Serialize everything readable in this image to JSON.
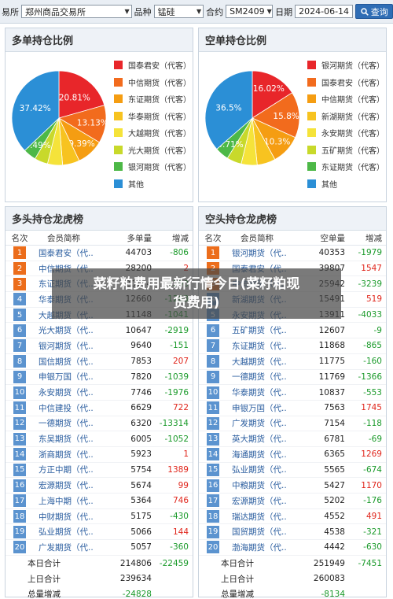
{
  "topbar": {
    "exchange_label": "易所",
    "exchange_value": "郑州商品交易所",
    "variety_label": "品种",
    "variety_value": "锰硅",
    "contract_label": "合约",
    "contract_value": "SM2409",
    "date_label": "日期",
    "date_value": "2024-06-14",
    "query_label": "查询"
  },
  "long_pie": {
    "title": "多单持仓比例",
    "slices": [
      {
        "name": "国泰君安（代客）",
        "pct": 20.81,
        "color": "#e8262a",
        "label": "20.81%"
      },
      {
        "name": "中信期货（代客）",
        "pct": 13.13,
        "color": "#f26b1d",
        "label": "13.13%"
      },
      {
        "name": "东证期货（代客）",
        "pct": 9.39,
        "color": "#f59d12",
        "label": "9.39%"
      },
      {
        "name": "华泰期货（代客）",
        "pct": 5.9,
        "color": "#f7c320",
        "label": ""
      },
      {
        "name": "大越期货（代客）",
        "pct": 5.2,
        "color": "#f5e33a",
        "label": ""
      },
      {
        "name": "光大期货（代客）",
        "pct": 4.6,
        "color": "#c8d92b",
        "label": ""
      },
      {
        "name": "银河期货（代客）",
        "pct": 4.49,
        "color": "#4db847",
        "label": "4.49%"
      },
      {
        "name": "其他",
        "pct": 37.42,
        "color": "#2b8fd6",
        "label": "37.42%"
      }
    ]
  },
  "short_pie": {
    "title": "空单持仓比例",
    "slices": [
      {
        "name": "银河期货（代客）",
        "pct": 16.02,
        "color": "#e8262a",
        "label": "16.02%"
      },
      {
        "name": "国泰君安（代客）",
        "pct": 15.8,
        "color": "#f26b1d",
        "label": "15.8%"
      },
      {
        "name": "中信期货（代客）",
        "pct": 10.3,
        "color": "#f59d12",
        "label": "10.3%"
      },
      {
        "name": "新湖期货（代客）",
        "pct": 6.3,
        "color": "#f7c320",
        "label": ""
      },
      {
        "name": "永安期货（代客）",
        "pct": 5.5,
        "color": "#f5e33a",
        "label": ""
      },
      {
        "name": "五矿期货（代客）",
        "pct": 5.07,
        "color": "#c8d92b",
        "label": ""
      },
      {
        "name": "东证期货（代客）",
        "pct": 4.71,
        "color": "#4db847",
        "label": "4.71%"
      },
      {
        "name": "其他",
        "pct": 36.5,
        "color": "#2b8fd6",
        "label": "36.5%"
      }
    ]
  },
  "long_table": {
    "title": "多头持仓龙虎榜",
    "headers": [
      "名次",
      "会员简称",
      "多单量",
      "增减"
    ],
    "rows": [
      {
        "rank": "1",
        "name": "国泰君安（代...",
        "vol": "44703",
        "chg": "-806"
      },
      {
        "rank": "2",
        "name": "中信期货（代...",
        "vol": "28200",
        "chg": "2"
      },
      {
        "rank": "3",
        "name": "东证期货（代...",
        "vol": "20174",
        "chg": "-1290"
      },
      {
        "rank": "4",
        "name": "华泰期货（代...",
        "vol": "12660",
        "chg": "-1263"
      },
      {
        "rank": "5",
        "name": "大越期货（代...",
        "vol": "11148",
        "chg": "-1041"
      },
      {
        "rank": "6",
        "name": "光大期货（代...",
        "vol": "10647",
        "chg": "-2919"
      },
      {
        "rank": "7",
        "name": "银河期货（代...",
        "vol": "9640",
        "chg": "-151"
      },
      {
        "rank": "8",
        "name": "国信期货（代...",
        "vol": "7853",
        "chg": "207"
      },
      {
        "rank": "9",
        "name": "申银万国（代...",
        "vol": "7820",
        "chg": "-1039"
      },
      {
        "rank": "10",
        "name": "永安期货（代...",
        "vol": "7746",
        "chg": "-1976"
      },
      {
        "rank": "11",
        "name": "中信建投（代...",
        "vol": "6629",
        "chg": "722"
      },
      {
        "rank": "12",
        "name": "一德期货（代...",
        "vol": "6320",
        "chg": "-13314"
      },
      {
        "rank": "13",
        "name": "东吴期货（代...",
        "vol": "6005",
        "chg": "-1052"
      },
      {
        "rank": "14",
        "name": "浙商期货（代...",
        "vol": "5923",
        "chg": "1"
      },
      {
        "rank": "15",
        "name": "方正中期（代...",
        "vol": "5754",
        "chg": "1389"
      },
      {
        "rank": "16",
        "name": "宏源期货（代...",
        "vol": "5674",
        "chg": "99"
      },
      {
        "rank": "17",
        "name": "上海中期（代...",
        "vol": "5364",
        "chg": "746"
      },
      {
        "rank": "18",
        "name": "中财期货（代...",
        "vol": "5175",
        "chg": "-430"
      },
      {
        "rank": "19",
        "name": "弘业期货（代...",
        "vol": "5066",
        "chg": "144"
      },
      {
        "rank": "20",
        "name": "广发期货（代...",
        "vol": "5057",
        "chg": "-360"
      }
    ],
    "summary": [
      {
        "label": "本日合计",
        "vol": "214806",
        "chg": "-22459"
      },
      {
        "label": "上日合计",
        "vol": "239634",
        "chg": ""
      },
      {
        "label": "总量增减",
        "vol": "-24828",
        "chg": ""
      }
    ]
  },
  "short_table": {
    "title": "空头持仓龙虎榜",
    "headers": [
      "名次",
      "会员简称",
      "空单量",
      "增减"
    ],
    "rows": [
      {
        "rank": "1",
        "name": "银河期货（代...",
        "vol": "40353",
        "chg": "-1979"
      },
      {
        "rank": "2",
        "name": "国泰君安（代...",
        "vol": "39807",
        "chg": "1547"
      },
      {
        "rank": "3",
        "name": "中信期货（代...",
        "vol": "25942",
        "chg": "-3239"
      },
      {
        "rank": "4",
        "name": "新湖期货（代...",
        "vol": "15491",
        "chg": "519"
      },
      {
        "rank": "5",
        "name": "永安期货（代...",
        "vol": "13911",
        "chg": "-4033"
      },
      {
        "rank": "6",
        "name": "五矿期货（代...",
        "vol": "12607",
        "chg": "-9"
      },
      {
        "rank": "7",
        "name": "东证期货（代...",
        "vol": "11868",
        "chg": "-865"
      },
      {
        "rank": "8",
        "name": "大越期货（代...",
        "vol": "11775",
        "chg": "-160"
      },
      {
        "rank": "9",
        "name": "一德期货（代...",
        "vol": "11769",
        "chg": "-1366"
      },
      {
        "rank": "10",
        "name": "华泰期货（代...",
        "vol": "10837",
        "chg": "-553"
      },
      {
        "rank": "11",
        "name": "申银万国（代...",
        "vol": "7563",
        "chg": "1745"
      },
      {
        "rank": "12",
        "name": "广发期货（代...",
        "vol": "7154",
        "chg": "-118"
      },
      {
        "rank": "13",
        "name": "英大期货（代...",
        "vol": "6781",
        "chg": "-69"
      },
      {
        "rank": "14",
        "name": "海通期货（代...",
        "vol": "6365",
        "chg": "1269"
      },
      {
        "rank": "15",
        "name": "弘业期货（代...",
        "vol": "5565",
        "chg": "-674"
      },
      {
        "rank": "16",
        "name": "中粮期货（代...",
        "vol": "5427",
        "chg": "1170"
      },
      {
        "rank": "17",
        "name": "宏源期货（代...",
        "vol": "5202",
        "chg": "-176"
      },
      {
        "rank": "18",
        "name": "瑞达期货（代...",
        "vol": "4552",
        "chg": "491"
      },
      {
        "rank": "19",
        "name": "国贸期货（代...",
        "vol": "4538",
        "chg": "-321"
      },
      {
        "rank": "20",
        "name": "渤海期货（代...",
        "vol": "4442",
        "chg": "-630"
      }
    ],
    "summary": [
      {
        "label": "本日合计",
        "vol": "251949",
        "chg": "-7451"
      },
      {
        "label": "上日合计",
        "vol": "260083",
        "chg": ""
      },
      {
        "label": "总量增减",
        "vol": "-8134",
        "chg": ""
      }
    ]
  },
  "overlay": {
    "line1": "菜籽粕费用最新行情今日(菜籽粕现",
    "line2": "货费用)"
  }
}
